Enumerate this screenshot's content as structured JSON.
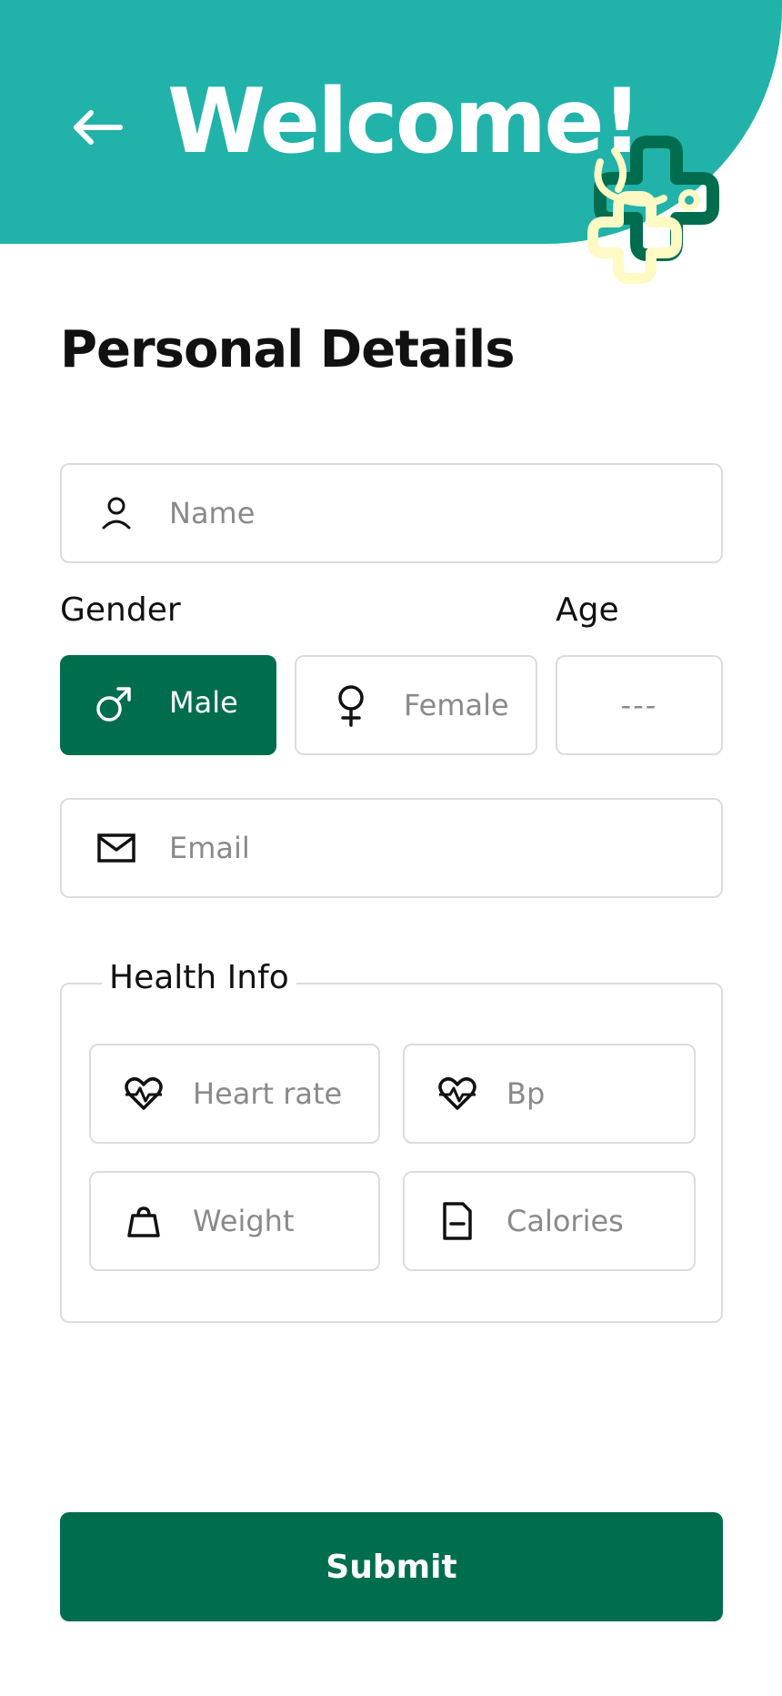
{
  "header": {
    "title": "Welcome!"
  },
  "section_title": "Personal Details",
  "fields": {
    "name": {
      "placeholder": "Name"
    },
    "email": {
      "placeholder": "Email"
    },
    "age": {
      "placeholder": "---"
    }
  },
  "gender": {
    "label": "Gender",
    "options": [
      {
        "label": "Male",
        "selected": true
      },
      {
        "label": "Female",
        "selected": false
      }
    ]
  },
  "age_label": "Age",
  "health_info": {
    "legend": "Health Info",
    "fields": [
      {
        "placeholder": "Heart rate",
        "icon": "heart-pulse-icon"
      },
      {
        "placeholder": "Bp",
        "icon": "heart-pulse-icon"
      },
      {
        "placeholder": "Weight",
        "icon": "weight-icon"
      },
      {
        "placeholder": "Calories",
        "icon": "document-icon"
      }
    ]
  },
  "submit_label": "Submit",
  "colors": {
    "header": "#21B2AA",
    "primary": "#006D4E",
    "border": "#DCDCDC",
    "placeholder": "#8A8A8A"
  }
}
